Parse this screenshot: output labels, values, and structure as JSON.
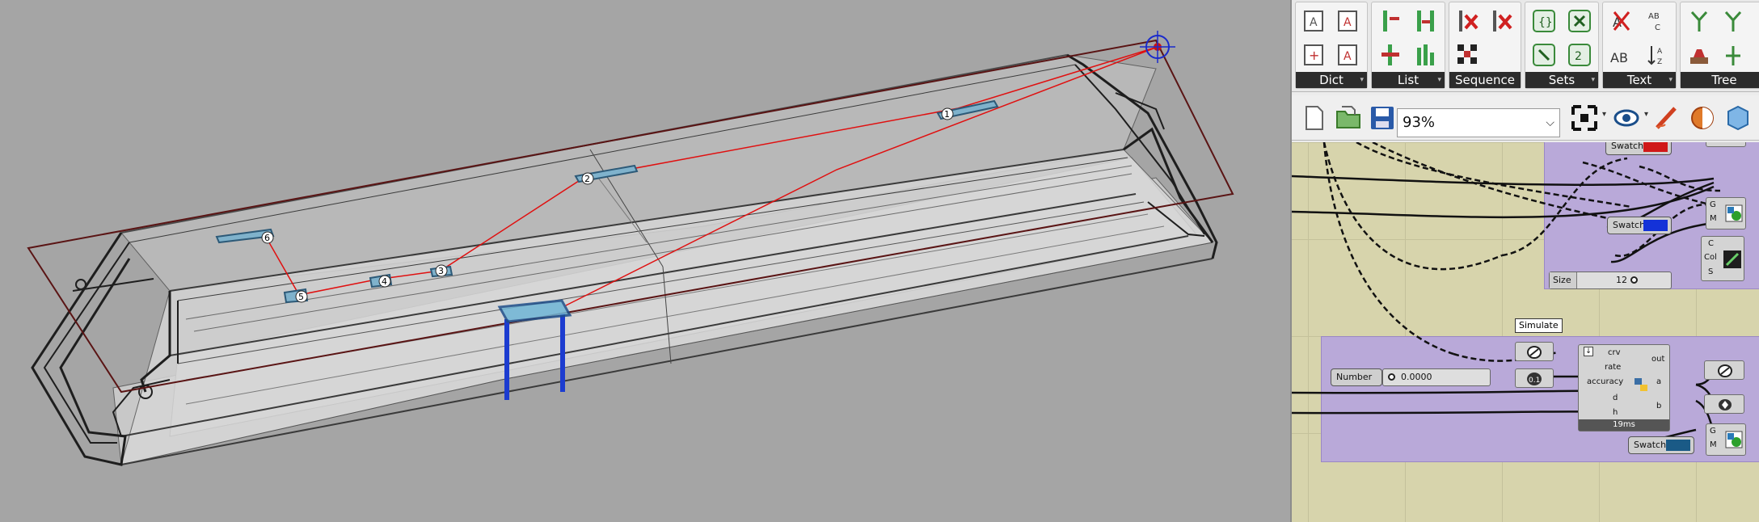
{
  "viewport": {
    "point_labels": [
      "1",
      "2",
      "3",
      "4",
      "5",
      "6"
    ]
  },
  "ribbon": {
    "groups": [
      {
        "label": "Dict",
        "icons": [
          "dict-a-icon",
          "dict-b-icon",
          "dict-add-icon",
          "dict-remove-icon"
        ]
      },
      {
        "label": "List",
        "icons": [
          "list-item-icon",
          "list-split-icon",
          "list-shift-icon",
          "list-sort-icon"
        ]
      },
      {
        "label": "Sequence",
        "icons": [
          "cull-pattern-icon",
          "cull-index-icon",
          "random-pattern-icon"
        ]
      },
      {
        "label": "Sets",
        "icons": [
          "set-union-icon",
          "set-delete-icon",
          "set-line-icon",
          "set-duplicate-icon"
        ]
      },
      {
        "label": "Text",
        "icons": [
          "text-match-icon",
          "text-replace-icon",
          "text-style-icon",
          "text-sort-icon"
        ]
      },
      {
        "label": "Tree",
        "icons": [
          "tree-branch-icon",
          "tree-flatten-icon"
        ]
      }
    ]
  },
  "toolbar": {
    "zoom": "93%"
  },
  "canvas": {
    "top_swatch": "Swatch",
    "swatch_blue": "Swatch",
    "preview_ports": [
      "G",
      "M"
    ],
    "color_ports": [
      "C",
      "Col",
      "S"
    ],
    "size_label": "Size",
    "size_value": "12",
    "tooltip": "Simulate",
    "number_label": "Number",
    "number_value": "0.0000",
    "script_inputs": [
      "crv",
      "rate",
      "accuracy",
      "d",
      "h"
    ],
    "script_outputs": [
      "out",
      "a",
      "b"
    ],
    "script_time": "19ms",
    "preview2_ports": [
      "G",
      "M"
    ],
    "swatch_bottom": "Swatch"
  },
  "colors": {
    "viewport_bg": "#a5a5a5",
    "canvas_bg": "#d7d4ac",
    "group_purple": "#b9a9d9",
    "curve_red": "#e01010",
    "swatch_red": "#d01818",
    "swatch_blue": "#1432d8",
    "swatch_teal": "#1a5a86"
  }
}
